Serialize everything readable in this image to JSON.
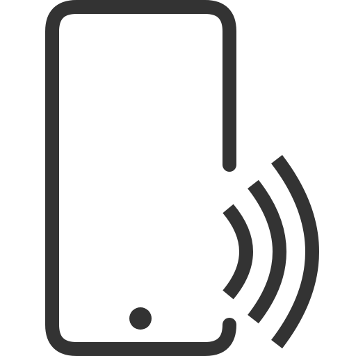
{
  "icon": {
    "name": "phone-nfc-icon",
    "stroke_color": "#333333",
    "background_color": "#ffffff",
    "signal_wave_count": 3
  }
}
